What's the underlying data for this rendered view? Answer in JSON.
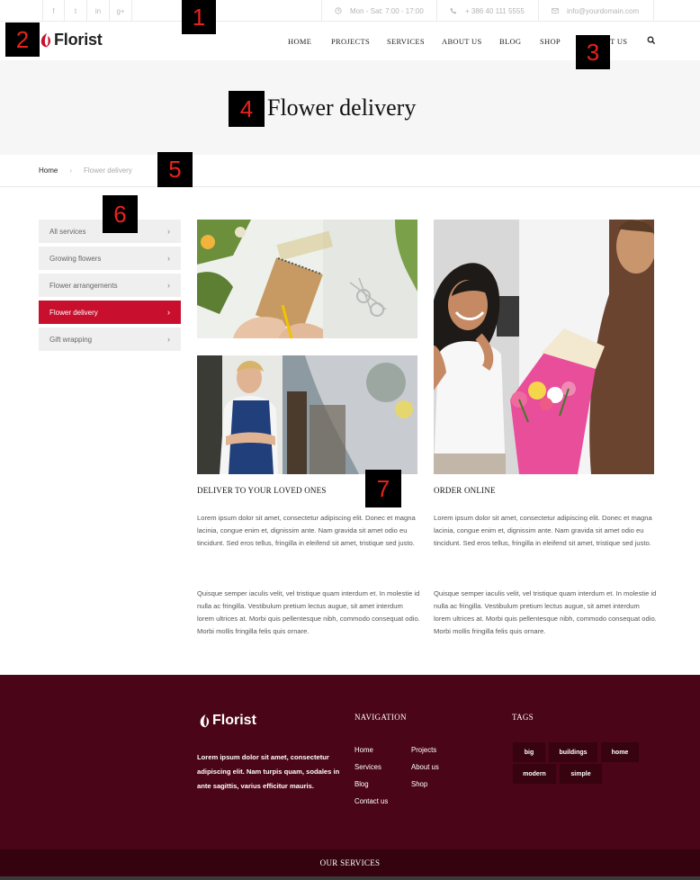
{
  "topbar": {
    "social": [
      {
        "icon": "facebook-icon",
        "glyph": "f"
      },
      {
        "icon": "twitter-icon",
        "glyph": "t"
      },
      {
        "icon": "linkedin-icon",
        "glyph": "in"
      },
      {
        "icon": "google-plus-icon",
        "glyph": "g+"
      }
    ],
    "hours": "Mon - Sat: 7:00 - 17:00",
    "phone": "+ 386 40 111 5555",
    "email": "info@yourdomain.com"
  },
  "brand": {
    "name": "Florist",
    "accent": "#c8102e"
  },
  "nav": {
    "items": [
      "HOME",
      "PROJECTS",
      "SERVICES",
      "ABOUT US",
      "BLOG",
      "SHOP",
      "CONTACT US"
    ]
  },
  "page": {
    "title": "Flower delivery"
  },
  "breadcrumb": {
    "home": "Home",
    "separator": "›",
    "current": "Flower delivery"
  },
  "sidebar": {
    "items": [
      {
        "label": "All services",
        "active": false
      },
      {
        "label": "Growing flowers",
        "active": false
      },
      {
        "label": "Flower arrangements",
        "active": false
      },
      {
        "label": "Flower delivery",
        "active": true
      },
      {
        "label": "Gift wrapping",
        "active": false
      }
    ],
    "chevron": "›"
  },
  "content": {
    "col1": {
      "title": "DELIVER TO YOUR LOVED ONES",
      "p1": "Lorem ipsum dolor sit amet, consectetur adipiscing elit. Donec et magna lacinia, congue enim et, dignissim ante. Nam gravida sit amet odio eu tincidunt. Sed eros tellus, fringilla in eleifend sit amet, tristique sed justo.",
      "p2": "Quisque semper iaculis velit, vel tristique quam interdum et. In molestie id nulla ac fringilla. Vestibulum pretium lectus augue, sit amet interdum lorem ultrices at. Morbi quis pellentesque nibh, commodo consequat odio. Morbi mollis fringilla felis quis ornare."
    },
    "col2": {
      "title": "ORDER ONLINE",
      "p1": "Lorem ipsum dolor sit amet, consectetur adipiscing elit. Donec et magna lacinia, congue enim et, dignissim ante. Nam gravida sit amet odio eu tincidunt. Sed eros tellus, fringilla in eleifend sit amet, tristique sed justo.",
      "p2": "Quisque semper iaculis velit, vel tristique quam interdum et. In molestie id nulla ac fringilla. Vestibulum pretium lectus augue, sit amet interdum lorem ultrices at. Morbi quis pellentesque nibh, commodo consequat odio. Morbi mollis fringilla felis quis ornare."
    }
  },
  "footer": {
    "brand": "Florist",
    "description": "Lorem ipsum dolor sit amet, consectetur adipiscing elit. Nam turpis quam, sodales in ante sagittis, varius efficitur mauris.",
    "nav_heading": "NAVIGATION",
    "nav_col1": [
      "Home",
      "Services",
      "Blog",
      "Contact us"
    ],
    "nav_col2": [
      "Projects",
      "About us",
      "Shop"
    ],
    "tags_heading": "TAGS",
    "tags": [
      "big",
      "buildings",
      "home",
      "modern",
      "simple"
    ],
    "background": "#4a0518"
  },
  "subfooter": {
    "title": "OUR SERVICES"
  },
  "badges": [
    "1",
    "2",
    "3",
    "4",
    "5",
    "6",
    "7"
  ]
}
